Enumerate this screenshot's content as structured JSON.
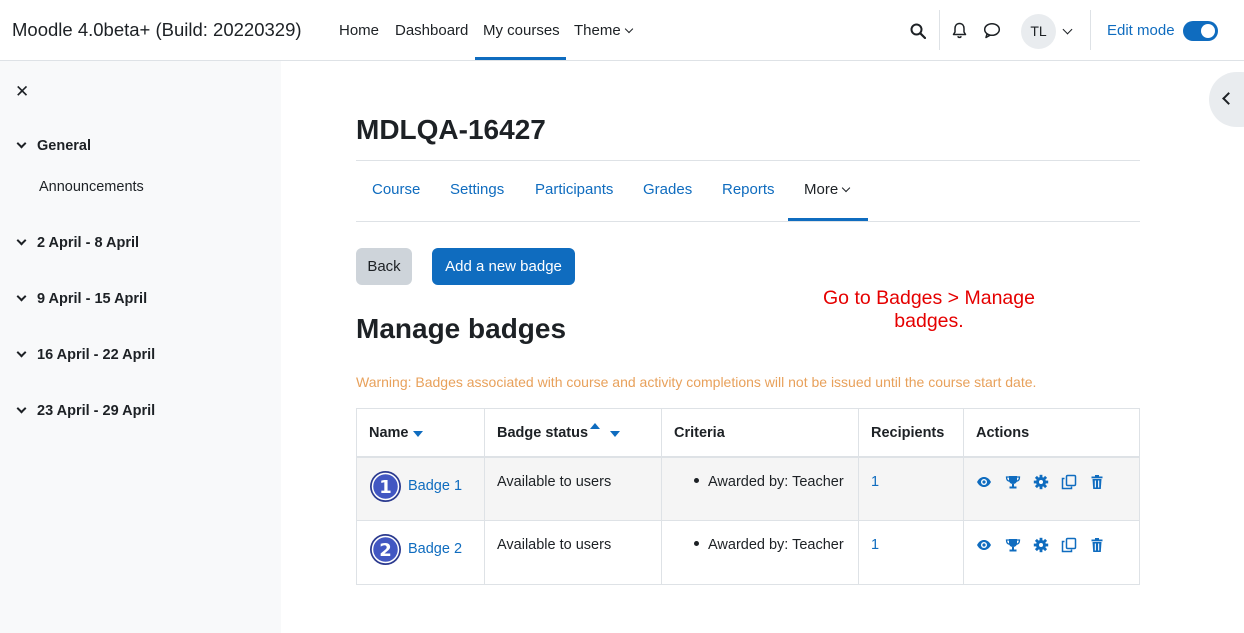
{
  "navbar": {
    "brand": "Moodle 4.0beta+ (Build: 20220329)",
    "links": [
      "Home",
      "Dashboard",
      "My courses",
      "Theme"
    ],
    "active": "My courses",
    "avatar_initials": "TL",
    "edit_mode_label": "Edit mode",
    "edit_mode_on": true
  },
  "drawer": {
    "sections": [
      {
        "title": "General",
        "items": [
          "Announcements"
        ]
      },
      {
        "title": "2 April - 8 April",
        "items": []
      },
      {
        "title": "9 April - 15 April",
        "items": []
      },
      {
        "title": "16 April - 22 April",
        "items": []
      },
      {
        "title": "23 April - 29 April",
        "items": []
      }
    ]
  },
  "course": {
    "title": "MDLQA-16427",
    "tabs": [
      "Course",
      "Settings",
      "Participants",
      "Grades",
      "Reports",
      "More"
    ],
    "active_tab": "More"
  },
  "buttons": {
    "back": "Back",
    "add_badge": "Add a new badge"
  },
  "annotation": {
    "line1": "Go to Badges > Manage",
    "line2": "badges."
  },
  "page": {
    "heading": "Manage badges",
    "warning": "Warning: Badges associated with course and activity completions will not be issued until the course start date."
  },
  "table": {
    "headers": [
      "Name",
      "Badge status",
      "Criteria",
      "Recipients",
      "Actions"
    ],
    "rows": [
      {
        "number": "1",
        "name": "Badge 1",
        "status": "Available to users",
        "criteria": "Awarded by: Teacher",
        "recipients": "1"
      },
      {
        "number": "2",
        "name": "Badge 2",
        "status": "Available to users",
        "criteria": "Awarded by: Teacher",
        "recipients": "1"
      }
    ],
    "action_icons": [
      "eye-icon",
      "trophy-icon",
      "gear-icon",
      "copy-icon",
      "trash-icon"
    ]
  },
  "colors": {
    "primary": "#0f6cbf",
    "warning": "#e8a15b",
    "annotation": "#e50000"
  }
}
